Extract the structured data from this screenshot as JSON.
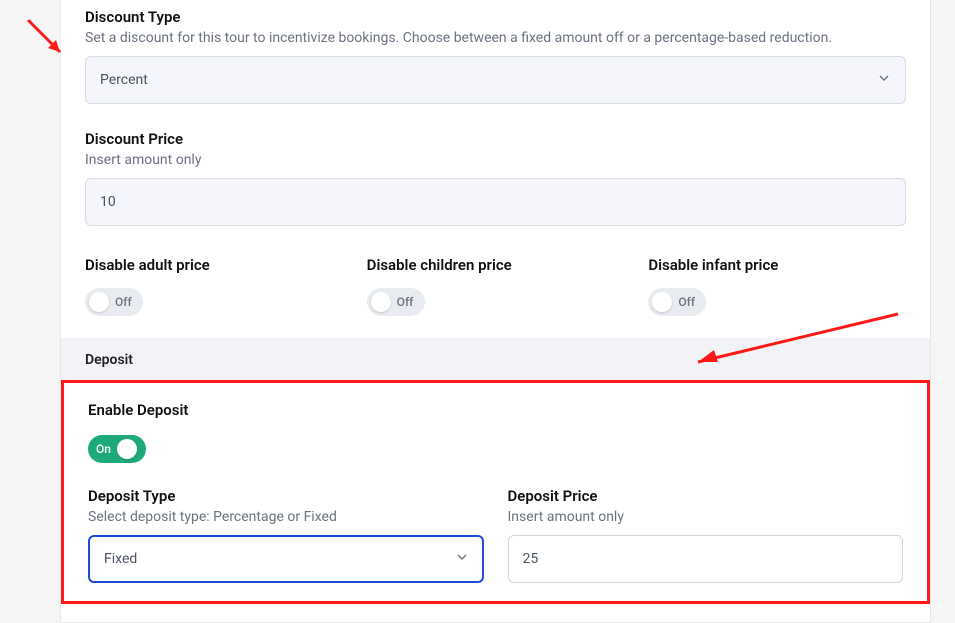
{
  "discount_type": {
    "label": "Discount Type",
    "help": "Set a discount for this tour to incentivize bookings. Choose between a fixed amount off or a percentage-based reduction.",
    "value": "Percent"
  },
  "discount_price": {
    "label": "Discount Price",
    "help": "Insert amount only",
    "value": "10"
  },
  "disable_adult": {
    "label": "Disable adult price",
    "state": "Off"
  },
  "disable_children": {
    "label": "Disable children price",
    "state": "Off"
  },
  "disable_infant": {
    "label": "Disable infant price",
    "state": "Off"
  },
  "deposit_section": {
    "title": "Deposit"
  },
  "enable_deposit": {
    "label": "Enable Deposit",
    "state": "On"
  },
  "deposit_type": {
    "label": "Deposit Type",
    "help": "Select deposit type: Percentage or Fixed",
    "value": "Fixed"
  },
  "deposit_price": {
    "label": "Deposit Price",
    "help": "Insert amount only",
    "value": "25"
  }
}
